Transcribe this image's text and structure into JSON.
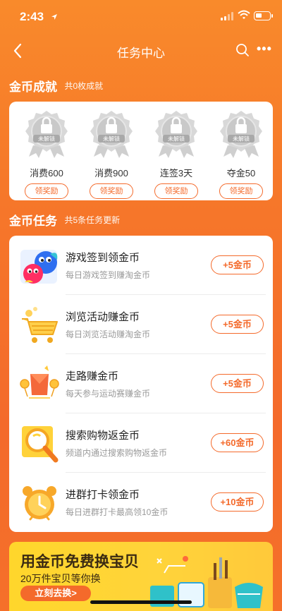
{
  "status_bar": {
    "time": "2:43",
    "battery_level": 0.45
  },
  "nav": {
    "title": "任务中心",
    "more": "•••"
  },
  "achievements": {
    "title": "金币成就",
    "subtitle": "共0枚成就",
    "badge_text": "未解锁",
    "items": [
      {
        "label": "消费600",
        "button": "领奖励"
      },
      {
        "label": "消费900",
        "button": "领奖励"
      },
      {
        "label": "连签3天",
        "button": "领奖励"
      },
      {
        "label": "夺金50",
        "button": "领奖励"
      }
    ]
  },
  "tasks": {
    "title": "金币任务",
    "subtitle": "共5条任务更新",
    "items": [
      {
        "title": "游戏签到领金币",
        "desc": "每日游戏签到赚淘金币",
        "reward": "+5金币",
        "icon": "game-character-icon"
      },
      {
        "title": "浏览活动赚金币",
        "desc": "每日浏览活动赚淘金币",
        "reward": "+5金币",
        "icon": "shopping-cart-icon"
      },
      {
        "title": "走路赚金币",
        "desc": "每天参与运动赛赚金币",
        "reward": "+5金币",
        "icon": "red-envelope-icon"
      },
      {
        "title": "搜索购物返金币",
        "desc": "频道内通过搜索购物返金币",
        "reward": "+60金币",
        "icon": "magnifier-icon"
      },
      {
        "title": "进群打卡领金币",
        "desc": "每日进群打卡最高领10金币",
        "reward": "+10金币",
        "icon": "alarm-clock-icon"
      }
    ]
  },
  "banner": {
    "title": "用金币免费换宝贝",
    "subtitle": "20万件宝贝等你换",
    "button": "立刻去换>"
  },
  "colors": {
    "accent": "#f46a2b",
    "background": "#f6782a",
    "banner": "#ffd62b"
  }
}
